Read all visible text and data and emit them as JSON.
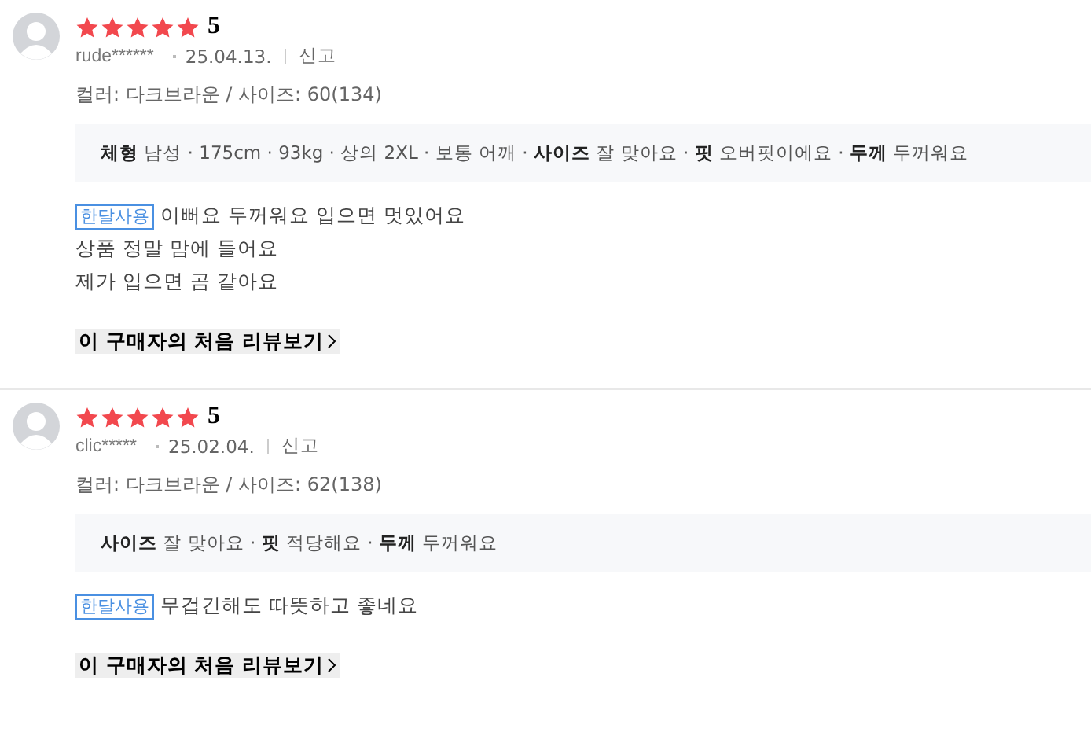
{
  "reviews": [
    {
      "stars": 5,
      "rating": "5",
      "user": "rude******",
      "date": "25.04.13.",
      "report": "신고",
      "option": "컬러: 다크브라운 / 사이즈: 60(134)",
      "details": "**체형** 남성 · 175cm · 93kg · 상의 2XL · 보통 어깨 · **사이즈** 잘 맞아요 · **핏** 오버핏이에요 · **두께** 두꺼워요",
      "tag": "한달사용",
      "lines": [
        "이뻐요 두꺼워요 입으면 멋있어요",
        "상품 정말 맘에 들어요",
        "제가 입으면 곰 같아요"
      ],
      "link": "이 구매자의 처음 리뷰보기"
    },
    {
      "stars": 5,
      "rating": "5",
      "user": "clic*****",
      "date": "25.02.04.",
      "report": "신고",
      "option": "컬러: 다크브라운 / 사이즈: 62(138)",
      "details": "**사이즈** 잘 맞아요 · **핏** 적당해요 · **두께** 두꺼워요",
      "tag": "한달사용",
      "lines": [
        "무겁긴해도 따뜻하고 좋네요"
      ],
      "link": "이 구매자의 처음 리뷰보기"
    }
  ]
}
